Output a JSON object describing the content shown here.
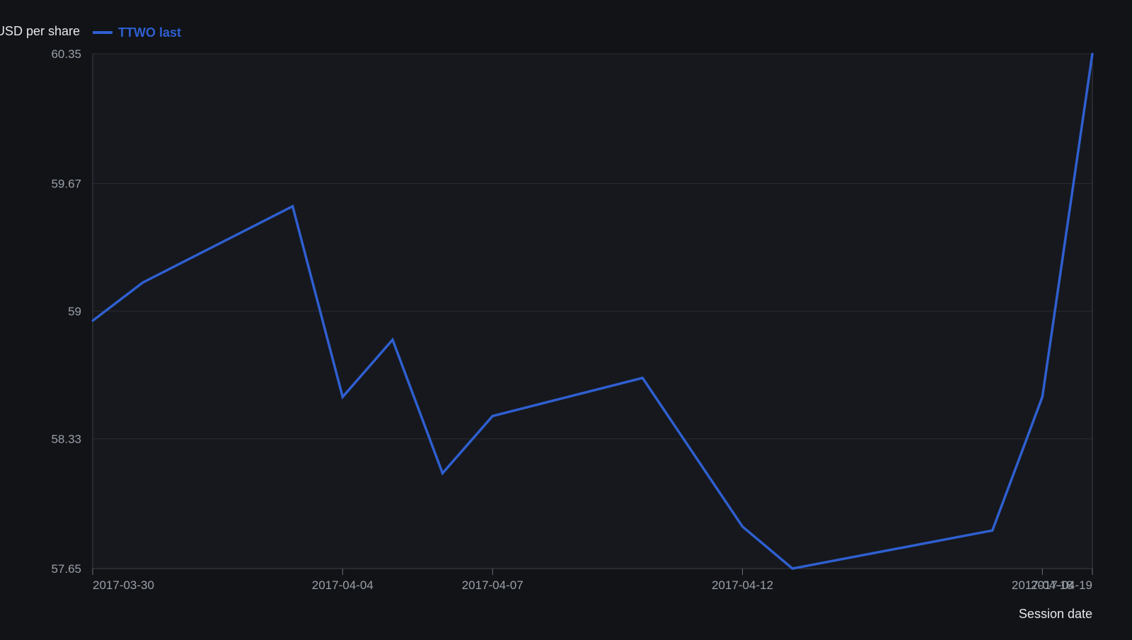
{
  "chart_data": {
    "type": "line",
    "ylabel": "USD per share",
    "xlabel": "Session date",
    "ylim": [
      57.65,
      60.35
    ],
    "y_ticks": [
      "57.65",
      "58.33",
      "59",
      "59.67",
      "60.35"
    ],
    "x_ticks": [
      "2017-03-30",
      "2017-04-04",
      "2017-04-07",
      "2017-04-12",
      "2017-04-18",
      "2017-04-19"
    ],
    "grid": true,
    "legend": "top-left",
    "colors": {
      "background": "#111317",
      "plot_background": "#16181d",
      "series": "#2f5fd0"
    },
    "series": [
      {
        "name": "TTWO last",
        "points": [
          {
            "x": "2017-03-30",
            "y": 58.95
          },
          {
            "x": "2017-03-31",
            "y": 59.15
          },
          {
            "x": "2017-04-03",
            "y": 59.55
          },
          {
            "x": "2017-04-04",
            "y": 58.55
          },
          {
            "x": "2017-04-05",
            "y": 58.85
          },
          {
            "x": "2017-04-06",
            "y": 58.15
          },
          {
            "x": "2017-04-07",
            "y": 58.45
          },
          {
            "x": "2017-04-10",
            "y": 58.65
          },
          {
            "x": "2017-04-12",
            "y": 57.87
          },
          {
            "x": "2017-04-13",
            "y": 57.65
          },
          {
            "x": "2017-04-17",
            "y": 57.85
          },
          {
            "x": "2017-04-18",
            "y": 58.55
          },
          {
            "x": "2017-04-19",
            "y": 60.35
          }
        ]
      }
    ]
  }
}
